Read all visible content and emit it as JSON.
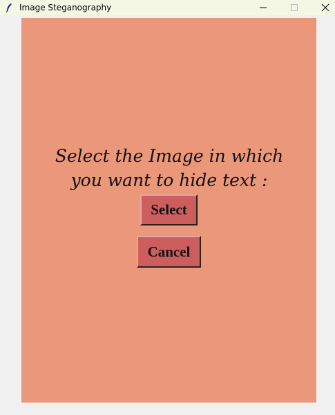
{
  "window": {
    "title": "Image Steganography",
    "icon": "feather-icon",
    "controls": [
      "minimize-icon",
      "maximize-icon",
      "close-icon"
    ]
  },
  "colors": {
    "titlebar_bg": "#f3f7e4",
    "panel_bg": "#ea977a",
    "button_bg": "#cc5e5e",
    "window_bg": "#f0f0f0"
  },
  "main": {
    "prompt_line1": "Select the Image in which",
    "prompt_line2": "you want to hide text :",
    "select_label": "Select",
    "cancel_label": "Cancel"
  }
}
